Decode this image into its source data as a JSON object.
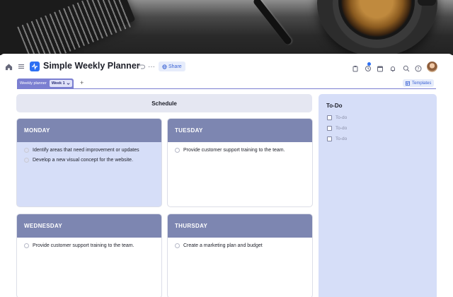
{
  "app": {
    "title": "Simple Weekly Planner",
    "share_label": "Share",
    "templates_label": "Templates",
    "add_tab": "+"
  },
  "tabs": {
    "group_label": "Weekly planner",
    "active_tab": "Week 1"
  },
  "schedule": {
    "header": "Schedule",
    "days": [
      {
        "name": "MONDAY",
        "tasks": [
          "Identify areas that need improvement or updates",
          "Develop a new visual concept for the website."
        ]
      },
      {
        "name": "TUESDAY",
        "tasks": [
          "Provide customer support training to the team."
        ]
      },
      {
        "name": "WEDNESDAY",
        "tasks": [
          "Provide customer support training to the team."
        ]
      },
      {
        "name": "THURSDAY",
        "tasks": [
          "Create a marketing plan and budget"
        ]
      }
    ]
  },
  "todo": {
    "title": "To-Do",
    "items": [
      "To-do",
      "To-do",
      "To-do"
    ]
  },
  "icons": {
    "home": "home-icon",
    "menu": "menu-icon",
    "undo": "undo-icon",
    "more": "more-icon",
    "share": "globe-icon",
    "templates": "templates-icon"
  },
  "colors": {
    "brand": "#2d6ff3",
    "day_header": "#7d86b1",
    "panel_bg": "#d6def8",
    "tab_accent": "#7b7fd1"
  }
}
